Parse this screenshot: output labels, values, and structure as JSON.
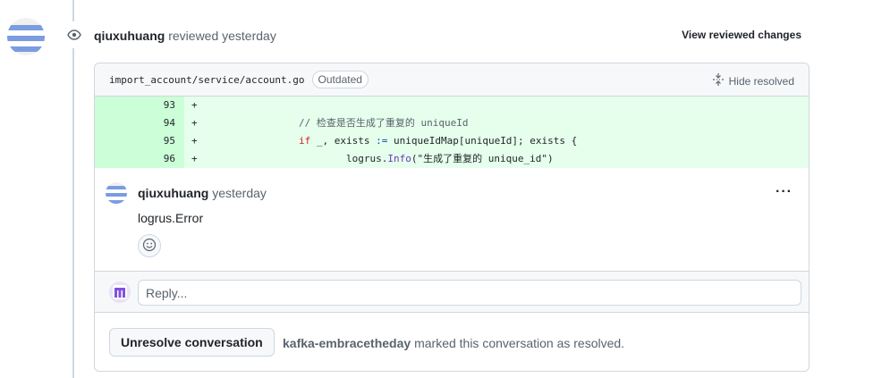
{
  "review": {
    "user": "qiuxuhuang",
    "action": "reviewed yesterday",
    "view_changes_label": "View reviewed changes"
  },
  "file": {
    "path": "import_account/service/account.go",
    "badge": "Outdated",
    "hide_resolved_label": "Hide resolved"
  },
  "diff": {
    "lines": [
      {
        "num": "93",
        "sign": "+"
      },
      {
        "num": "94",
        "sign": "+",
        "comment": "// 检查是否生成了重复的 uniqueId"
      },
      {
        "num": "95",
        "sign": "+",
        "kw1": "if",
        "rest": " _, exists ",
        "op": ":=",
        "tail": " uniqueIdMap[uniqueId]; exists {"
      },
      {
        "num": "96",
        "sign": "+",
        "pre": "logrus.",
        "fn": "Info",
        "args": "(\"生成了重复的 unique_id\")"
      }
    ]
  },
  "comment": {
    "user": "qiuxuhuang",
    "time": "yesterday",
    "body": "logrus.Error"
  },
  "reply": {
    "placeholder": "Reply..."
  },
  "resolution": {
    "button_label": "Unresolve conversation",
    "user": "kafka-embracetheday",
    "text": " marked this conversation as resolved."
  },
  "colors": {
    "added_bg": "#e6ffec",
    "added_num_bg": "#ccffd8",
    "avatar_blue": "#6f8fd8"
  },
  "icons": [
    "eye-icon",
    "unfold-icon",
    "kebab-icon",
    "smiley-icon"
  ]
}
